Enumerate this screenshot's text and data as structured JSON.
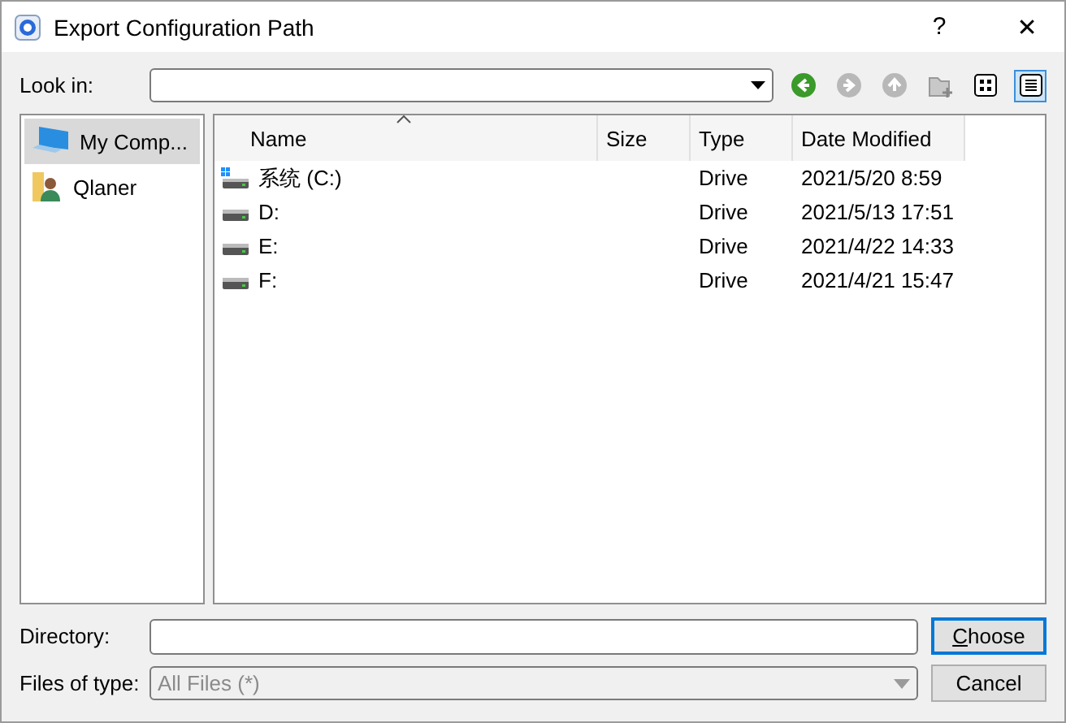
{
  "window": {
    "title": "Export Configuration Path",
    "help": "?",
    "close": "✕"
  },
  "look_in": {
    "label": "Look in:"
  },
  "toolbar": [
    {
      "kind": "back",
      "disabled": false
    },
    {
      "kind": "forward",
      "disabled": true
    },
    {
      "kind": "up",
      "disabled": true
    },
    {
      "kind": "new-folder",
      "disabled": true
    },
    {
      "kind": "icon-view",
      "selected": false
    },
    {
      "kind": "detail-view",
      "selected": true
    }
  ],
  "sidebar": {
    "items": [
      {
        "kind": "computer",
        "label": "My Comp...",
        "selected": true
      },
      {
        "kind": "user",
        "label": "Qlaner",
        "selected": false
      }
    ]
  },
  "table": {
    "columns": [
      "Name",
      "Size",
      "Type",
      "Date Modified"
    ],
    "rows": [
      {
        "kind": "system",
        "name": "系统 (C:)",
        "type": "Drive",
        "date": "2021/5/20 8:59"
      },
      {
        "kind": "drive",
        "name": "D:",
        "type": "Drive",
        "date": "2021/5/13 17:51"
      },
      {
        "kind": "drive",
        "name": "E:",
        "type": "Drive",
        "date": "2021/4/22 14:33"
      },
      {
        "kind": "drive",
        "name": "F:",
        "type": "Drive",
        "date": "2021/4/21 15:47"
      }
    ]
  },
  "directory": {
    "label": "Directory:"
  },
  "file_type": {
    "label": "Files of type:",
    "value": "All Files (*)",
    "disabled": true
  },
  "buttons": [
    {
      "label": "Choose",
      "default": true
    },
    {
      "label": "Cancel",
      "default": false
    }
  ]
}
